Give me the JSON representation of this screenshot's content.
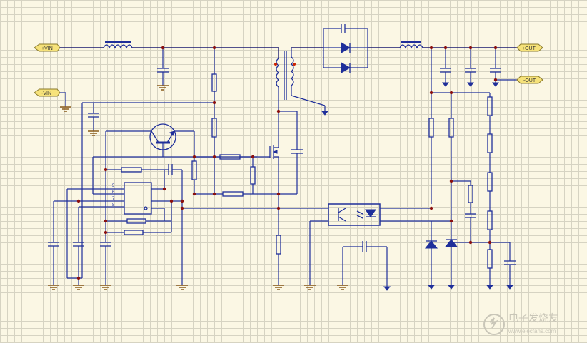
{
  "ports": {
    "vin_pos": "+VIN",
    "vin_neg": "-VIN",
    "out_pos": "+OUT",
    "out_neg": "-OUT"
  },
  "ic_pins": [
    "5",
    "6",
    "7",
    "8"
  ],
  "watermark": {
    "title": "电子发烧友",
    "url": "www.elecfans.com"
  },
  "colors": {
    "wire": "#1f2f9a",
    "ground": "#8a5a1a",
    "junction": "#8b1010",
    "port_fill": "#f6e27a",
    "background": "#fbf7e4"
  }
}
